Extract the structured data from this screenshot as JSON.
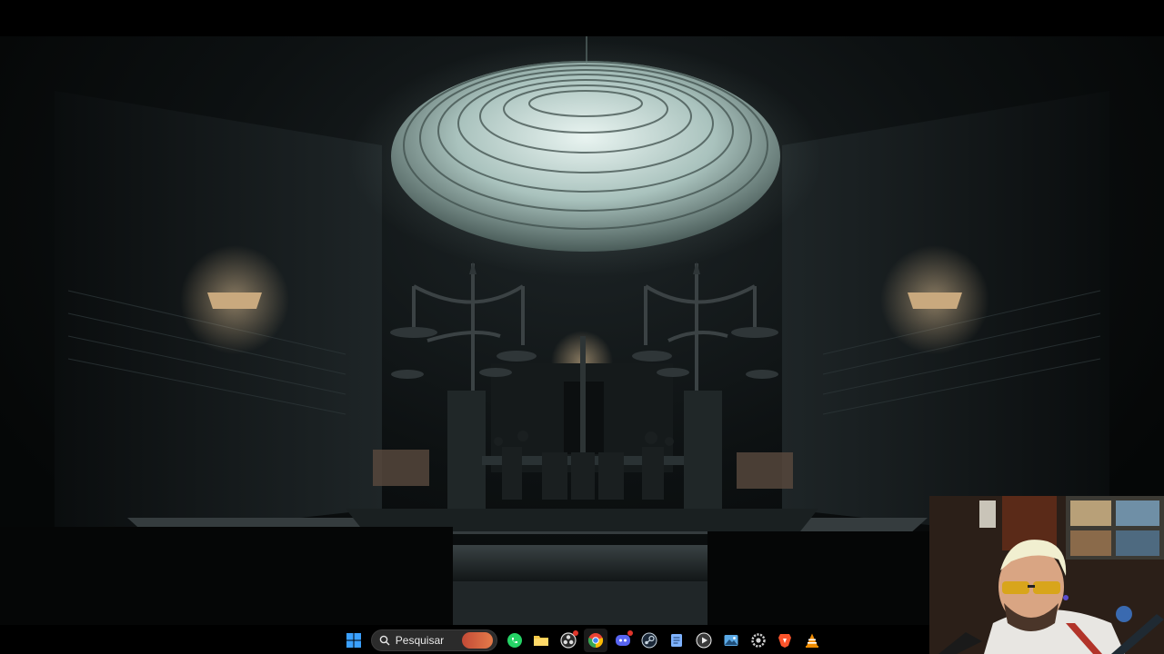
{
  "taskbar": {
    "search_placeholder": "Pesquisar",
    "apps": [
      {
        "name": "start-icon",
        "color": "#3aa0ff"
      },
      {
        "name": "whatsapp-icon",
        "color": "#25d366"
      },
      {
        "name": "file-explorer-icon",
        "color": "#f7c948"
      },
      {
        "name": "obs-icon",
        "color": "#dddddd"
      },
      {
        "name": "chrome-icon",
        "color": "#4285f4"
      },
      {
        "name": "discord-icon",
        "color": "#5865f2"
      },
      {
        "name": "steam-icon",
        "color": "#1b2838"
      },
      {
        "name": "notepad-icon",
        "color": "#7fb3ff"
      },
      {
        "name": "media-player-icon",
        "color": "#f0f0f0"
      },
      {
        "name": "photos-icon",
        "color": "#5aa9e6"
      },
      {
        "name": "settings-icon",
        "color": "#cfcfcf"
      },
      {
        "name": "brave-icon",
        "color": "#fb542b"
      },
      {
        "name": "vlc-icon",
        "color": "#f08c00"
      }
    ]
  },
  "colors": {
    "skylight": "#cfe3df",
    "stone": "#1c2224",
    "lamp": "#e8c89a"
  }
}
